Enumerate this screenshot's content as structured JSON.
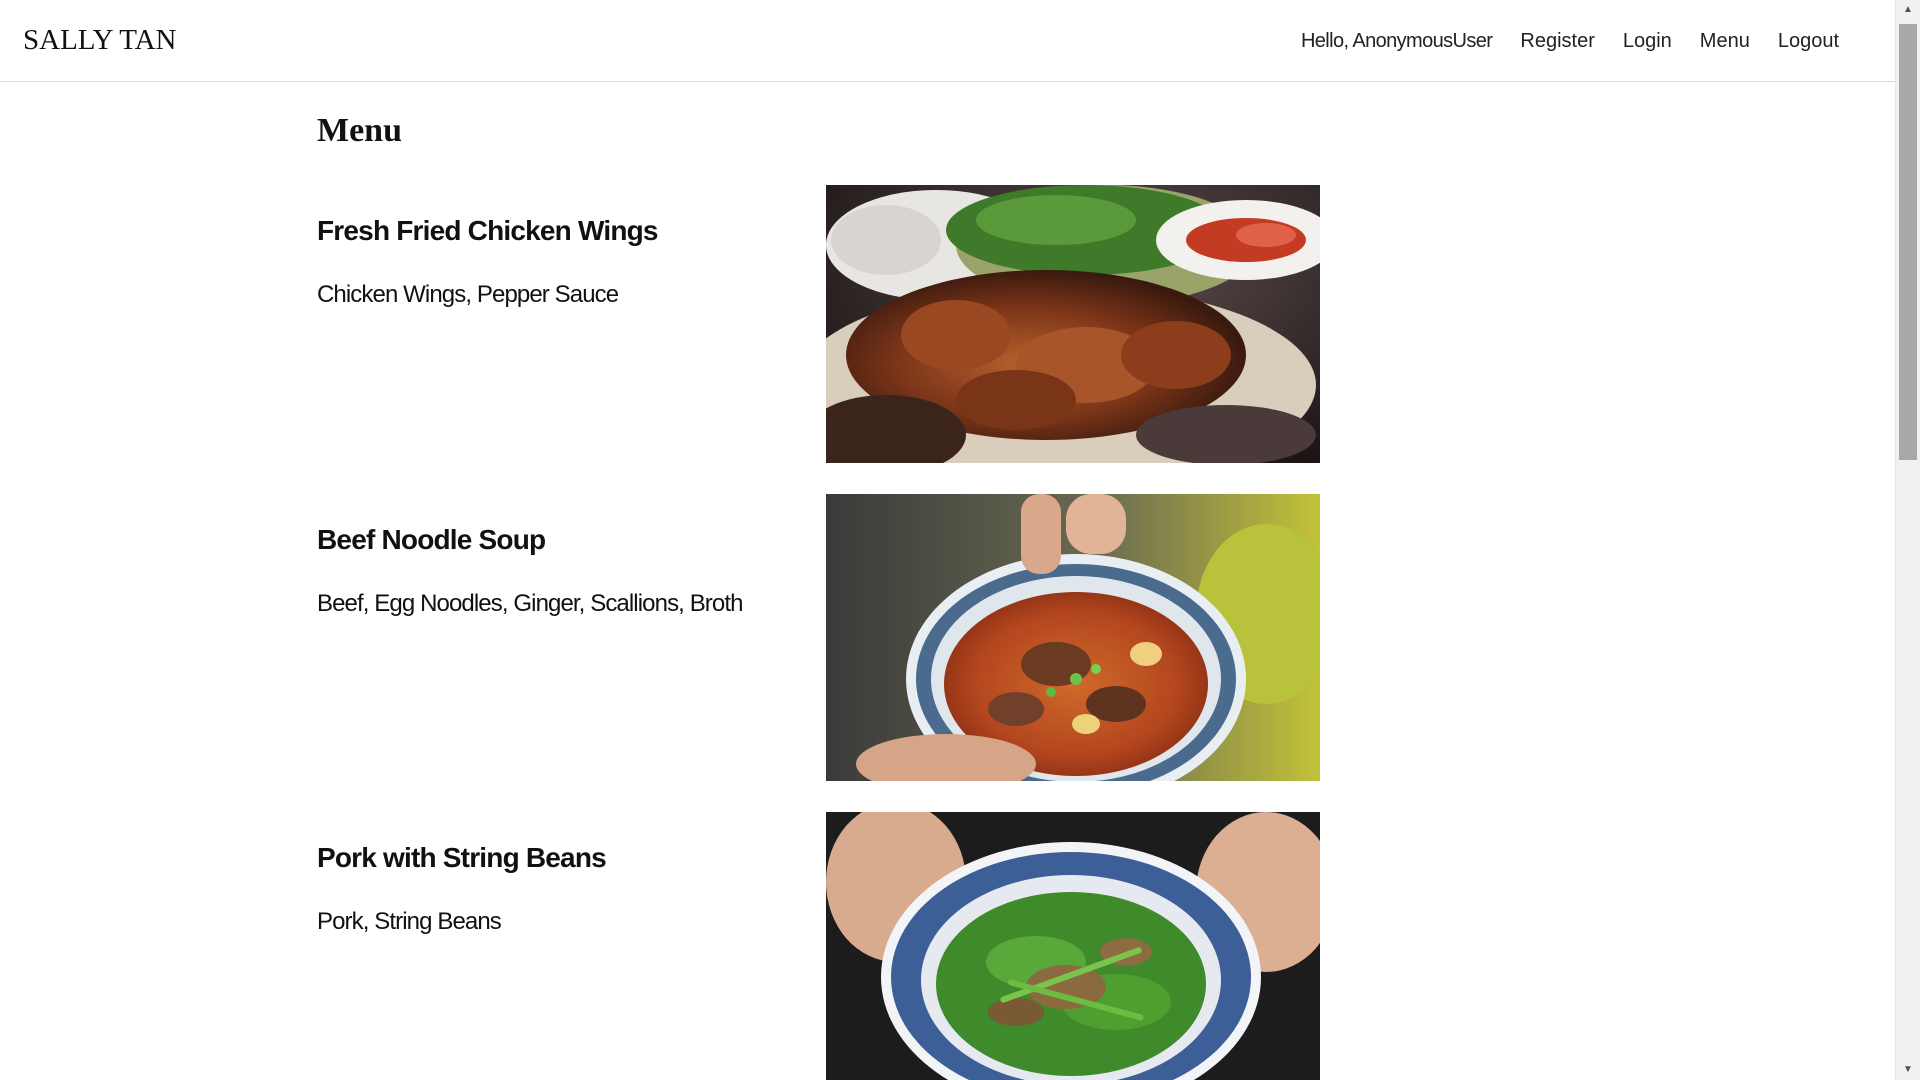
{
  "header": {
    "brand": "SALLY TAN",
    "greeting": "Hello, AnonymousUser",
    "nav": [
      {
        "label": "Register"
      },
      {
        "label": "Login"
      },
      {
        "label": "Menu"
      },
      {
        "label": "Logout"
      }
    ]
  },
  "main": {
    "title": "Menu",
    "items": [
      {
        "name": "Fresh Fried Chicken Wings",
        "description": "Chicken Wings, Pepper Sauce",
        "image_alt": "grilled chicken wings platter"
      },
      {
        "name": "Beef Noodle Soup",
        "description": "Beef, Egg Noodles, Ginger, Scallions, Broth",
        "image_alt": "bowl of beef noodle soup"
      },
      {
        "name": "Pork with String Beans",
        "description": "Pork, String Beans",
        "image_alt": "bowl of pork with string beans"
      }
    ]
  },
  "scrollbar": {
    "up_icon": "triangle-up-icon",
    "down_icon": "triangle-down-icon"
  }
}
